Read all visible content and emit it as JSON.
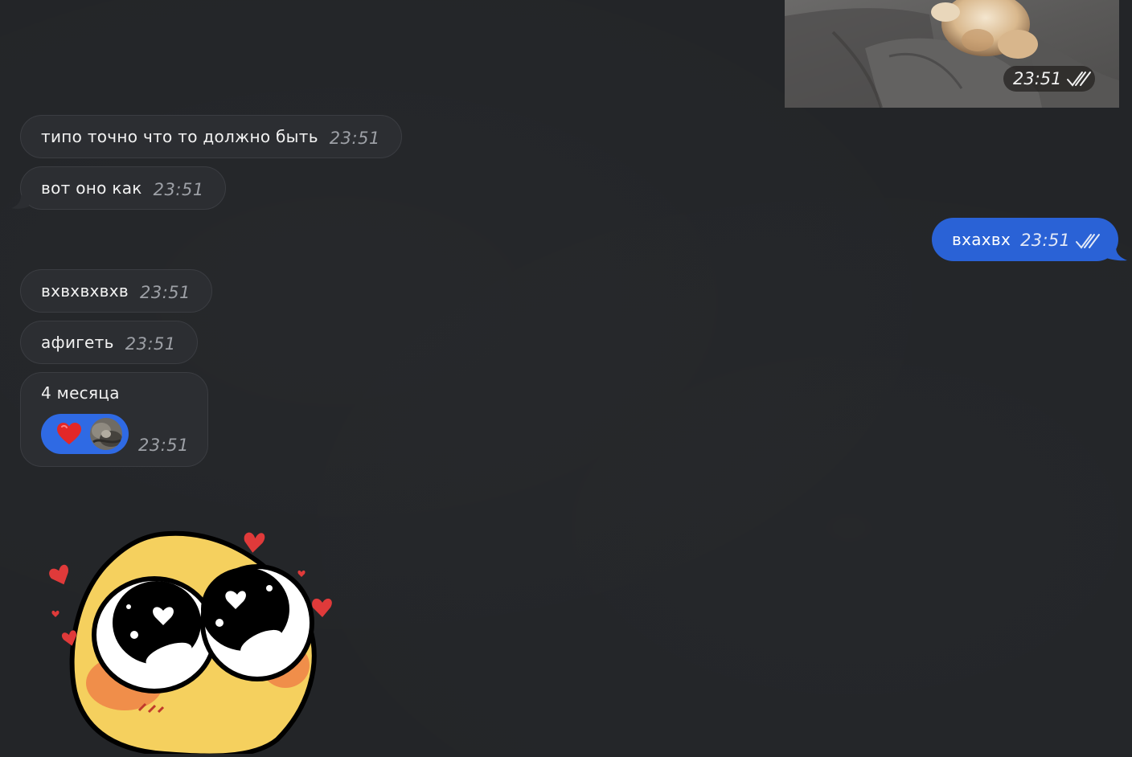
{
  "outgoing_media": {
    "time": "23:51"
  },
  "incoming": [
    {
      "text": "типо точно что то должно быть",
      "time": "23:51"
    },
    {
      "text": "вот оно как",
      "time": "23:51"
    },
    {
      "text": "вхвхвхвхв",
      "time": "23:51"
    },
    {
      "text": "афигеть",
      "time": "23:51"
    }
  ],
  "outgoing": [
    {
      "text": "вхахвх",
      "time": "23:51"
    }
  ],
  "reaction_message": {
    "text": "4 месяца",
    "time": "23:51",
    "reaction_emoji": "heart-icon"
  },
  "colors": {
    "background": "#232528",
    "incoming_bubble": "#2c2e32",
    "outgoing_bubble": "#2a62d6",
    "reaction_pill": "#2f6ae4",
    "timestamp": "#9da0a6"
  }
}
